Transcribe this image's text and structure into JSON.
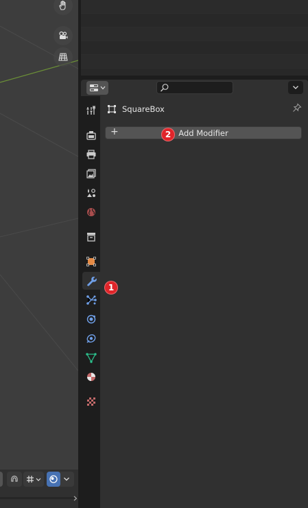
{
  "viewport": {
    "gizmo_icons": [
      "hand-pan-icon",
      "camera-icon",
      "grid-view-icon"
    ],
    "footer_icons": [
      "snap-icon",
      "transform-pivot-icon",
      "overlay-icon"
    ]
  },
  "properties": {
    "search": {
      "placeholder": ""
    },
    "object_name": "SquareBox",
    "add_modifier_plus": "+",
    "add_modifier_label": "Add Modifier",
    "tabs": [
      "tool-icon",
      "render-icon",
      "output-icon",
      "view-layer-icon",
      "scene-icon",
      "world-icon",
      "collection-icon",
      "object-icon",
      "modifier-wrench-icon",
      "particles-icon",
      "physics-icon",
      "constraints-icon",
      "data-icon",
      "material-icon",
      "texture-icon"
    ],
    "active_tab": "modifier-wrench-icon"
  },
  "annotations": {
    "badge_1": "1",
    "badge_2": "2"
  },
  "colors": {
    "accent_blue": "#4772b3",
    "badge_red": "#e0252a",
    "object_orange": "#e58b46"
  }
}
